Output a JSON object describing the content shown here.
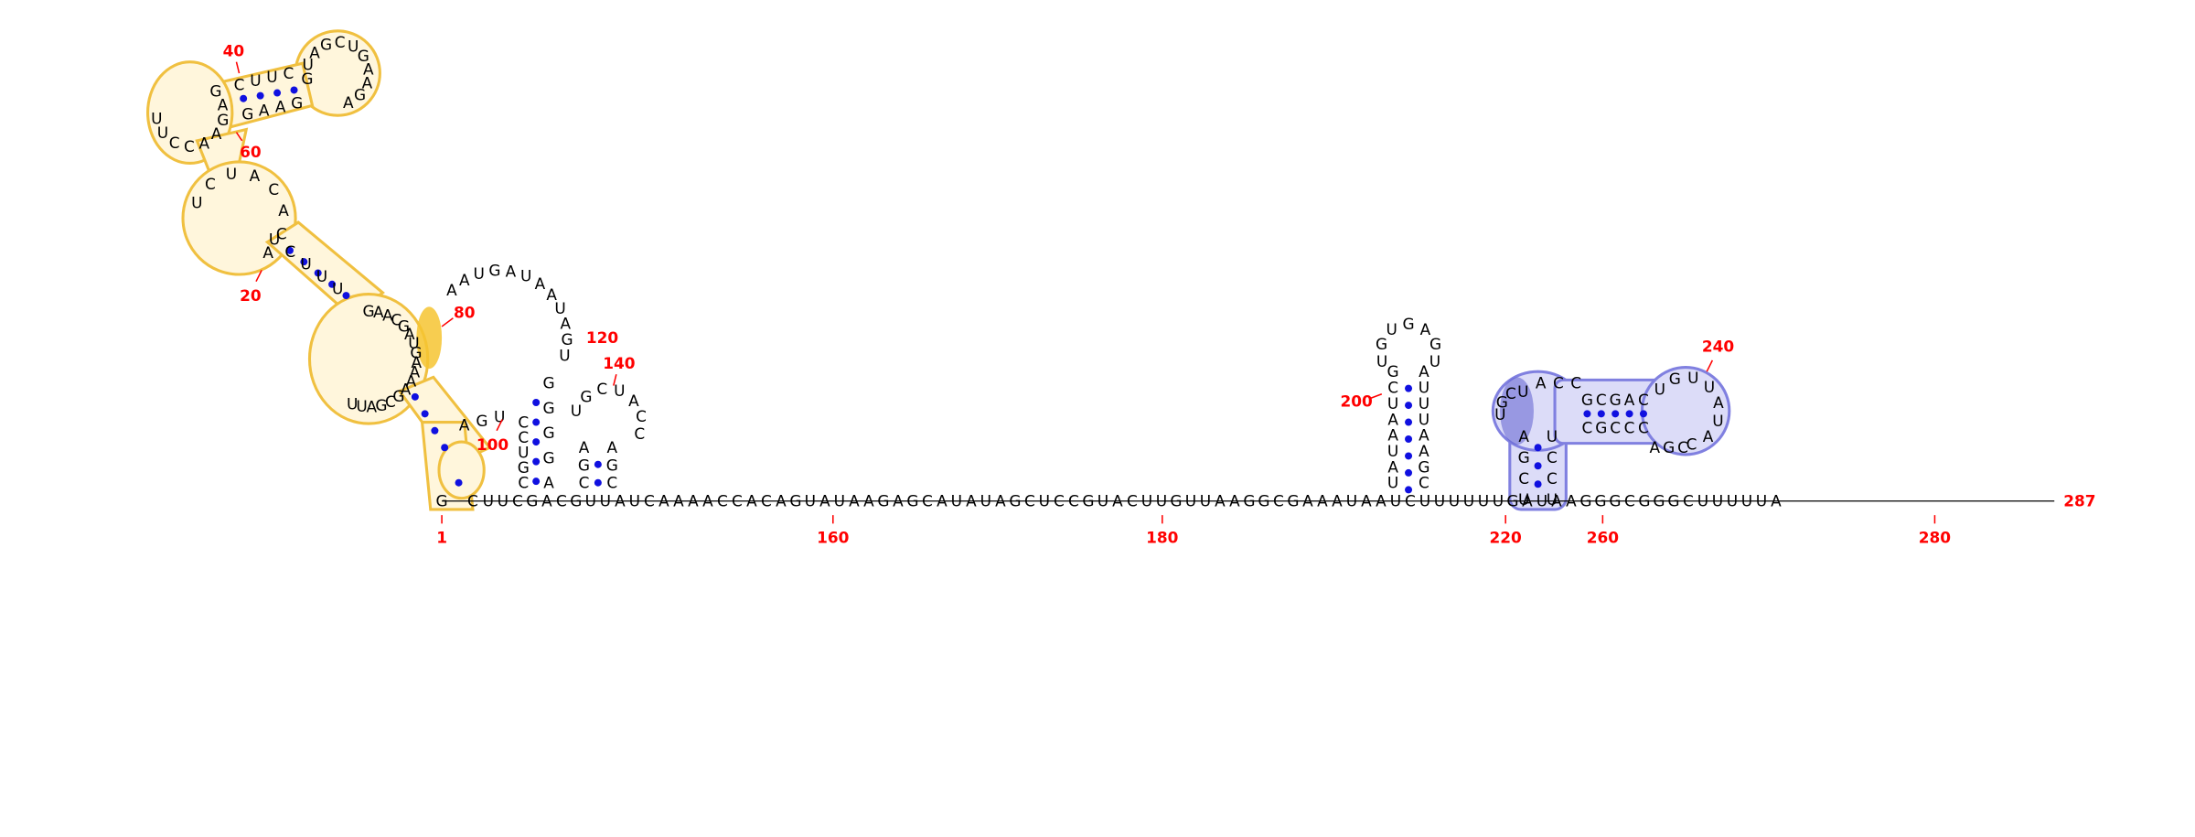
{
  "colors": {
    "nucleotide": "#000000",
    "base_pair_dot": "#1010e0",
    "position_label": "#ff0000",
    "backbone": "#000000",
    "highlight_orange_stroke": "#f0c040",
    "highlight_orange_fill": "#fff6dc",
    "highlight_orange_strong": "#f6c431",
    "highlight_blue_stroke": "#8080e0",
    "highlight_blue_fill": "#dcdcf8",
    "highlight_blue_strong": "#6060d0"
  },
  "position_labels": [
    "1",
    "20",
    "40",
    "60",
    "80",
    "100",
    "120",
    "140",
    "160",
    "180",
    "200",
    "220",
    "240",
    "260",
    "280",
    "287"
  ],
  "linear_tail": "UUCGACGUUAUCAAAACCACAGUAUAAGAGCAUAUAGCUCCGUACUUGUUAAGGCGAAAUAAUCUUUUUUGAUAAGGGCGGGCUUUUUA",
  "hairpin_200": {
    "left": "GCUAAUAU",
    "loop": "UGUGAGU",
    "right": "AUUUAAGC"
  },
  "domain_blue": {
    "stem_left": "AGCU",
    "stem_right": "UCCU",
    "bulge": "UGCU",
    "upper_loop": "ACC",
    "inner_top": "GCGAC",
    "inner_bottom": "CGCCC",
    "apical_loop": "UGUUAUAC",
    "lower_loop": "AGC"
  },
  "domain_orange": {
    "apical_loop": "GUAGCUGAAGA",
    "stem_top": "CUUC",
    "stem_bottom": "GAAG",
    "left_loop": "GAGAACCUU",
    "middle_loop": "UCUACACA",
    "lower_stem": "UCUUU",
    "lower_loop": "GAACGAUGAAAAGCGAUU"
  },
  "domain_middle": {
    "big_loop": "AAUGAUAAUAGU",
    "stem_left": "CCUGC",
    "stem_right": "GGGGA",
    "small_loop": "UGCUACC",
    "linker": "AGU",
    "bottom_pair": "AGC"
  }
}
